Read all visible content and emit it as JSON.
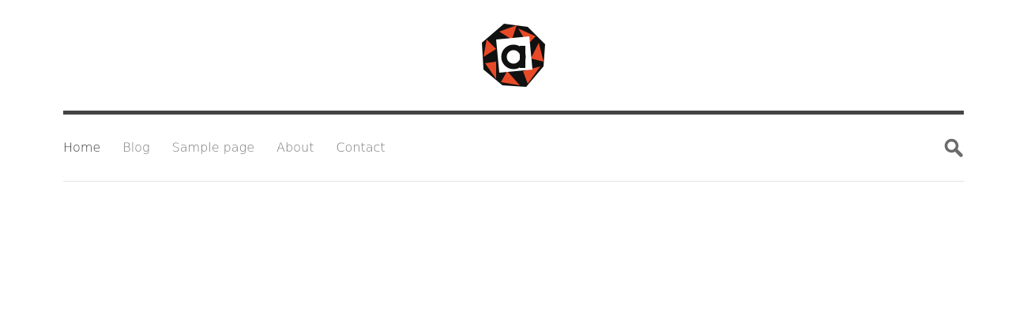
{
  "site": {
    "logo_letter": "a",
    "logo_colors": {
      "accent": "#e84a27",
      "dark": "#111111"
    }
  },
  "nav": {
    "items": [
      {
        "label": "Home",
        "active": true
      },
      {
        "label": "Blog",
        "active": false
      },
      {
        "label": "Sample page",
        "active": false
      },
      {
        "label": "About",
        "active": false
      },
      {
        "label": "Contact",
        "active": false
      }
    ],
    "search_icon": "search-icon",
    "colors": {
      "rule": "#444444",
      "text": "#777777",
      "active_text": "#333333",
      "divider": "#e3e3e3"
    }
  }
}
